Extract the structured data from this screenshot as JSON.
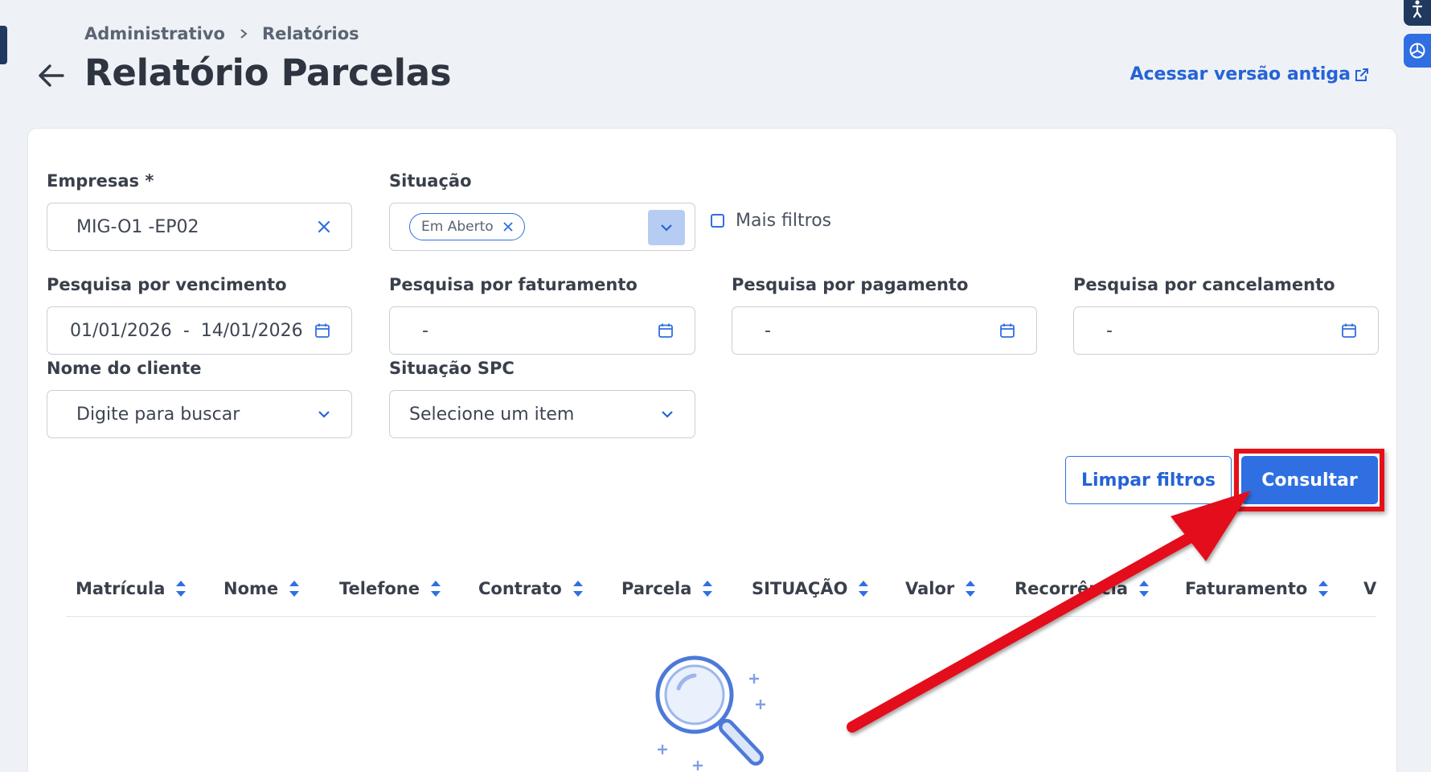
{
  "breadcrumb": {
    "items": [
      "Administrativo",
      "Relatórios"
    ]
  },
  "page": {
    "title": "Relatório Parcelas",
    "old_version_link": "Acessar versão antiga"
  },
  "filters": {
    "empresas": {
      "label": "Empresas *",
      "value": "MIG-O1 -EP02"
    },
    "situacao": {
      "label": "Situação",
      "chip": "Em Aberto"
    },
    "mais_filtros": "Mais filtros",
    "vencimento": {
      "label": "Pesquisa por vencimento",
      "start": "01/01/2026",
      "separator": "-",
      "end": "14/01/2026"
    },
    "faturamento": {
      "label": "Pesquisa por faturamento",
      "value": "-"
    },
    "pagamento": {
      "label": "Pesquisa por pagamento",
      "value": "-"
    },
    "cancelamento": {
      "label": "Pesquisa por cancelamento",
      "value": "-"
    },
    "cliente": {
      "label": "Nome do cliente",
      "placeholder": "Digite para buscar"
    },
    "spc": {
      "label": "Situação SPC",
      "placeholder": "Selecione um item"
    }
  },
  "actions": {
    "clear": "Limpar filtros",
    "submit": "Consultar"
  },
  "table": {
    "columns": [
      "Matrícula",
      "Nome",
      "Telefone",
      "Contrato",
      "Parcela",
      "SITUAÇÃO",
      "Valor",
      "Recorrência",
      "Faturamento",
      "V"
    ]
  },
  "colors": {
    "primary": "#2f6fe2",
    "annotation": "#e3101a",
    "background": "#eef1f5"
  }
}
